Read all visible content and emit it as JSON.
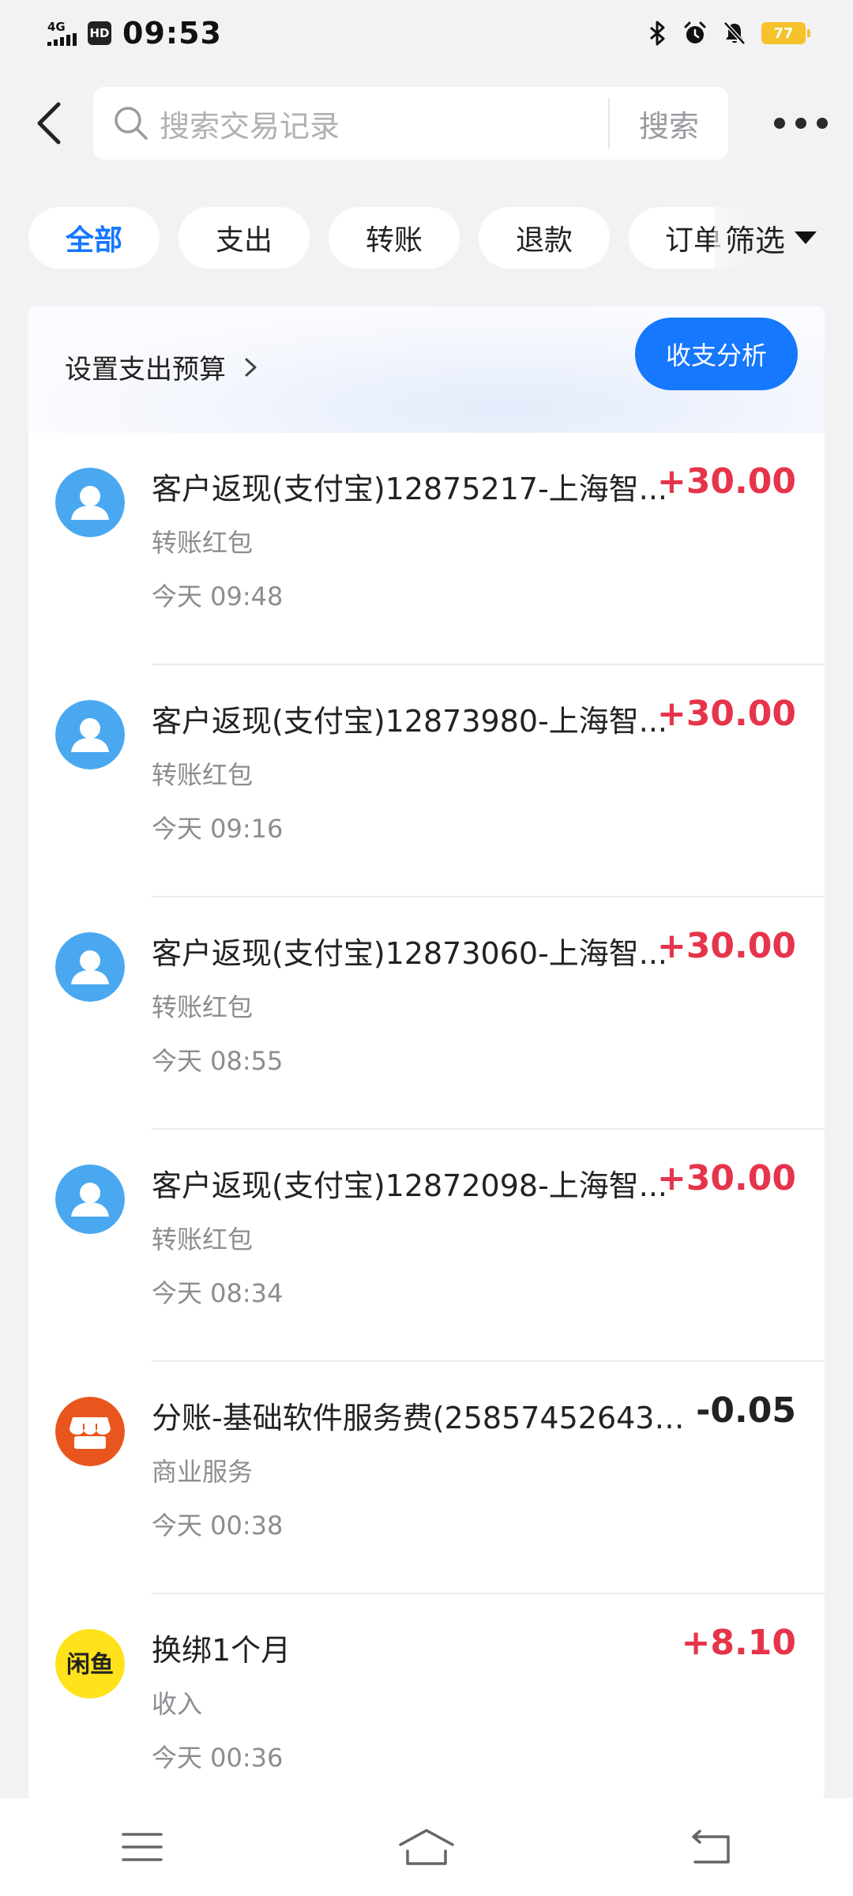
{
  "status_bar": {
    "network": "4G",
    "hd": "HD",
    "time": "09:53",
    "battery": "77"
  },
  "header": {
    "search_placeholder": "搜索交易记录",
    "search_button": "搜索"
  },
  "filters": {
    "tabs": [
      "全部",
      "支出",
      "转账",
      "退款",
      "订单"
    ],
    "active_index": 0,
    "filter_label": "筛选"
  },
  "budget": {
    "link_label": "设置支出预算",
    "analysis_button": "收支分析"
  },
  "transactions": [
    {
      "title": "客户返现(支付宝)12875217-上海智...",
      "amount": "+30.00",
      "category": "转账红包",
      "time": "今天 09:48",
      "icon": "user-avatar-icon"
    },
    {
      "title": "客户返现(支付宝)12873980-上海智...",
      "amount": "+30.00",
      "category": "转账红包",
      "time": "今天 09:16",
      "icon": "user-avatar-icon"
    },
    {
      "title": "客户返现(支付宝)12873060-上海智...",
      "amount": "+30.00",
      "category": "转账红包",
      "time": "今天 08:55",
      "icon": "user-avatar-icon"
    },
    {
      "title": "客户返现(支付宝)12872098-上海智...",
      "amount": "+30.00",
      "category": "转账红包",
      "time": "今天 08:34",
      "icon": "user-avatar-icon"
    },
    {
      "title": "分账-基础软件服务费(258574526433...",
      "amount": "-0.05",
      "category": "商业服务",
      "time": "今天 00:38",
      "icon": "shop-icon"
    },
    {
      "title": "换绑1个月",
      "amount": "+8.10",
      "category": "收入",
      "time": "今天 00:36",
      "icon": "xianyu-logo-icon",
      "logo_text": "闲鱼"
    }
  ],
  "colors": {
    "accent": "#1677ff",
    "income": "#e6344a",
    "avatar_blue": "#4aa8f0",
    "shop_orange": "#e8561e",
    "xianyu_yellow": "#ffe21a"
  }
}
